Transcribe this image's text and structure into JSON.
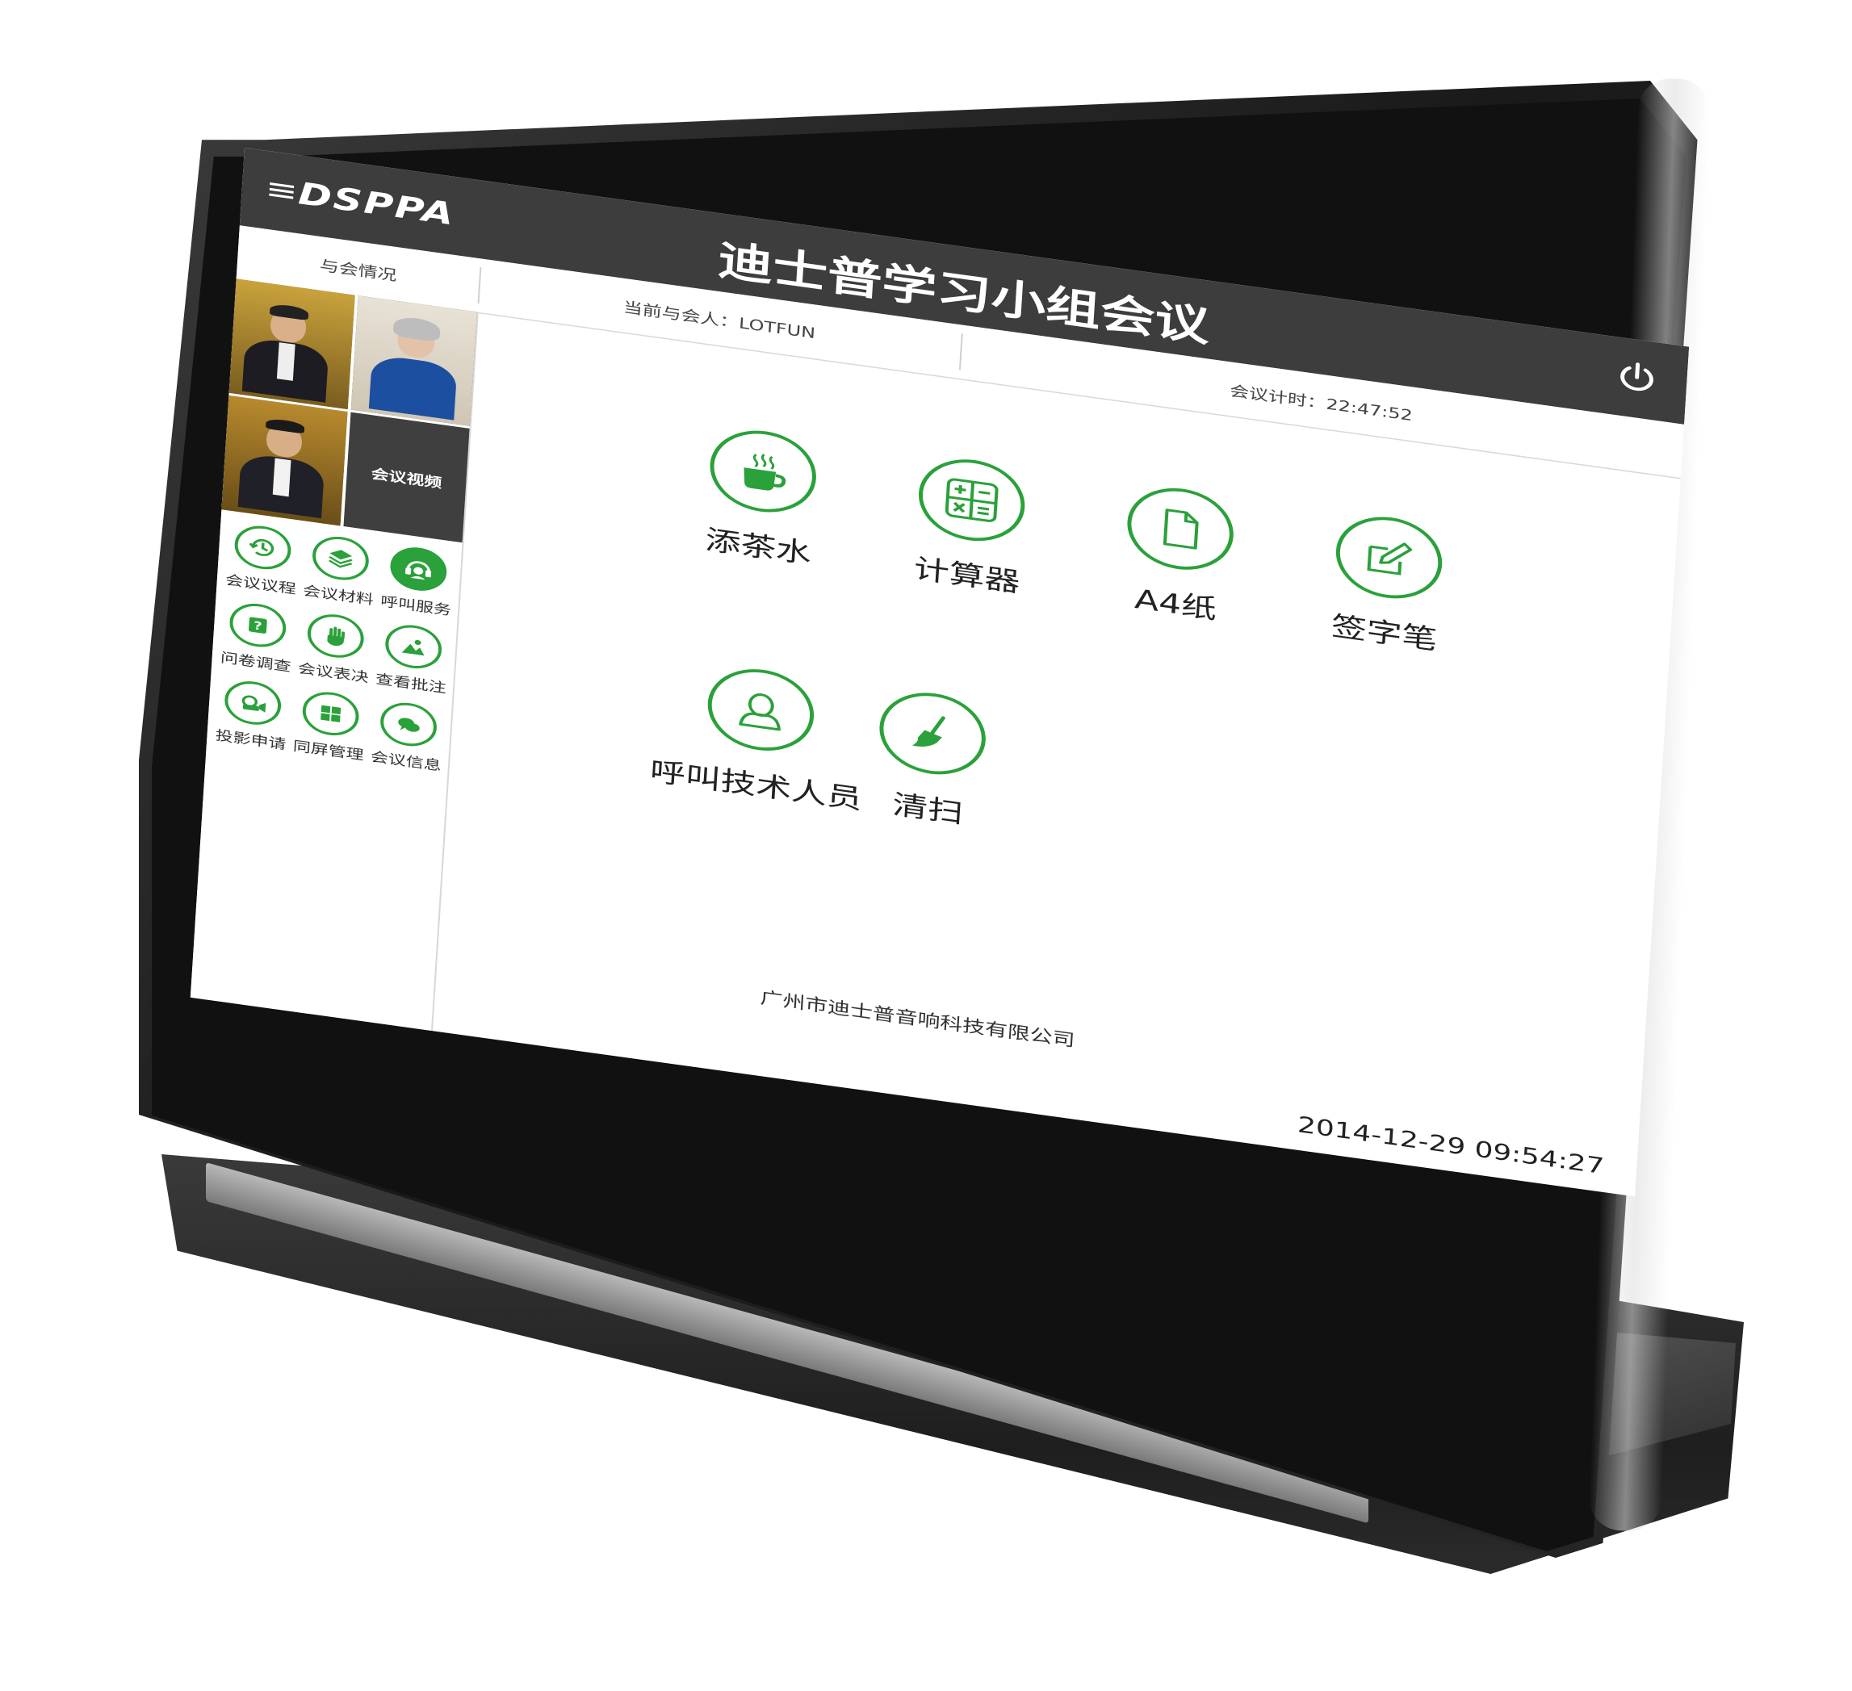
{
  "header": {
    "logo_text": "DSPPA",
    "title": "迪士普学习小组会议",
    "power_icon": "power-icon"
  },
  "infobar": {
    "attendance_label": "与会情况",
    "current_attendee": "当前与会人：LOTFUN",
    "meeting_timer": "会议计时：22:47:52"
  },
  "sidebar": {
    "video_label": "会议视频",
    "menu": [
      {
        "label": "会议议程",
        "icon": "history-icon"
      },
      {
        "label": "会议材料",
        "icon": "layers-icon"
      },
      {
        "label": "呼叫服务",
        "icon": "headset-icon"
      },
      {
        "label": "问卷调查",
        "icon": "question-icon"
      },
      {
        "label": "会议表决",
        "icon": "hand-icon"
      },
      {
        "label": "查看批注",
        "icon": "picture-icon"
      },
      {
        "label": "投影申请",
        "icon": "camera-icon"
      },
      {
        "label": "同屏管理",
        "icon": "grid-icon"
      },
      {
        "label": "会议信息",
        "icon": "chat-icon"
      }
    ]
  },
  "services": [
    {
      "label": "添茶水",
      "icon": "tea-cup-icon"
    },
    {
      "label": "计算器",
      "icon": "calculator-icon"
    },
    {
      "label": "A4纸",
      "icon": "document-icon"
    },
    {
      "label": "签字笔",
      "icon": "pen-icon"
    },
    {
      "label": "呼叫技术人员",
      "icon": "person-icon"
    },
    {
      "label": "清扫",
      "icon": "broom-icon"
    }
  ],
  "footer": {
    "company": "广州市迪士普音响科技有限公司",
    "datetime": "2014-12-29 09:54:27"
  },
  "colors": {
    "accent": "#2aa13a",
    "header_bg": "#3d3d3d"
  }
}
